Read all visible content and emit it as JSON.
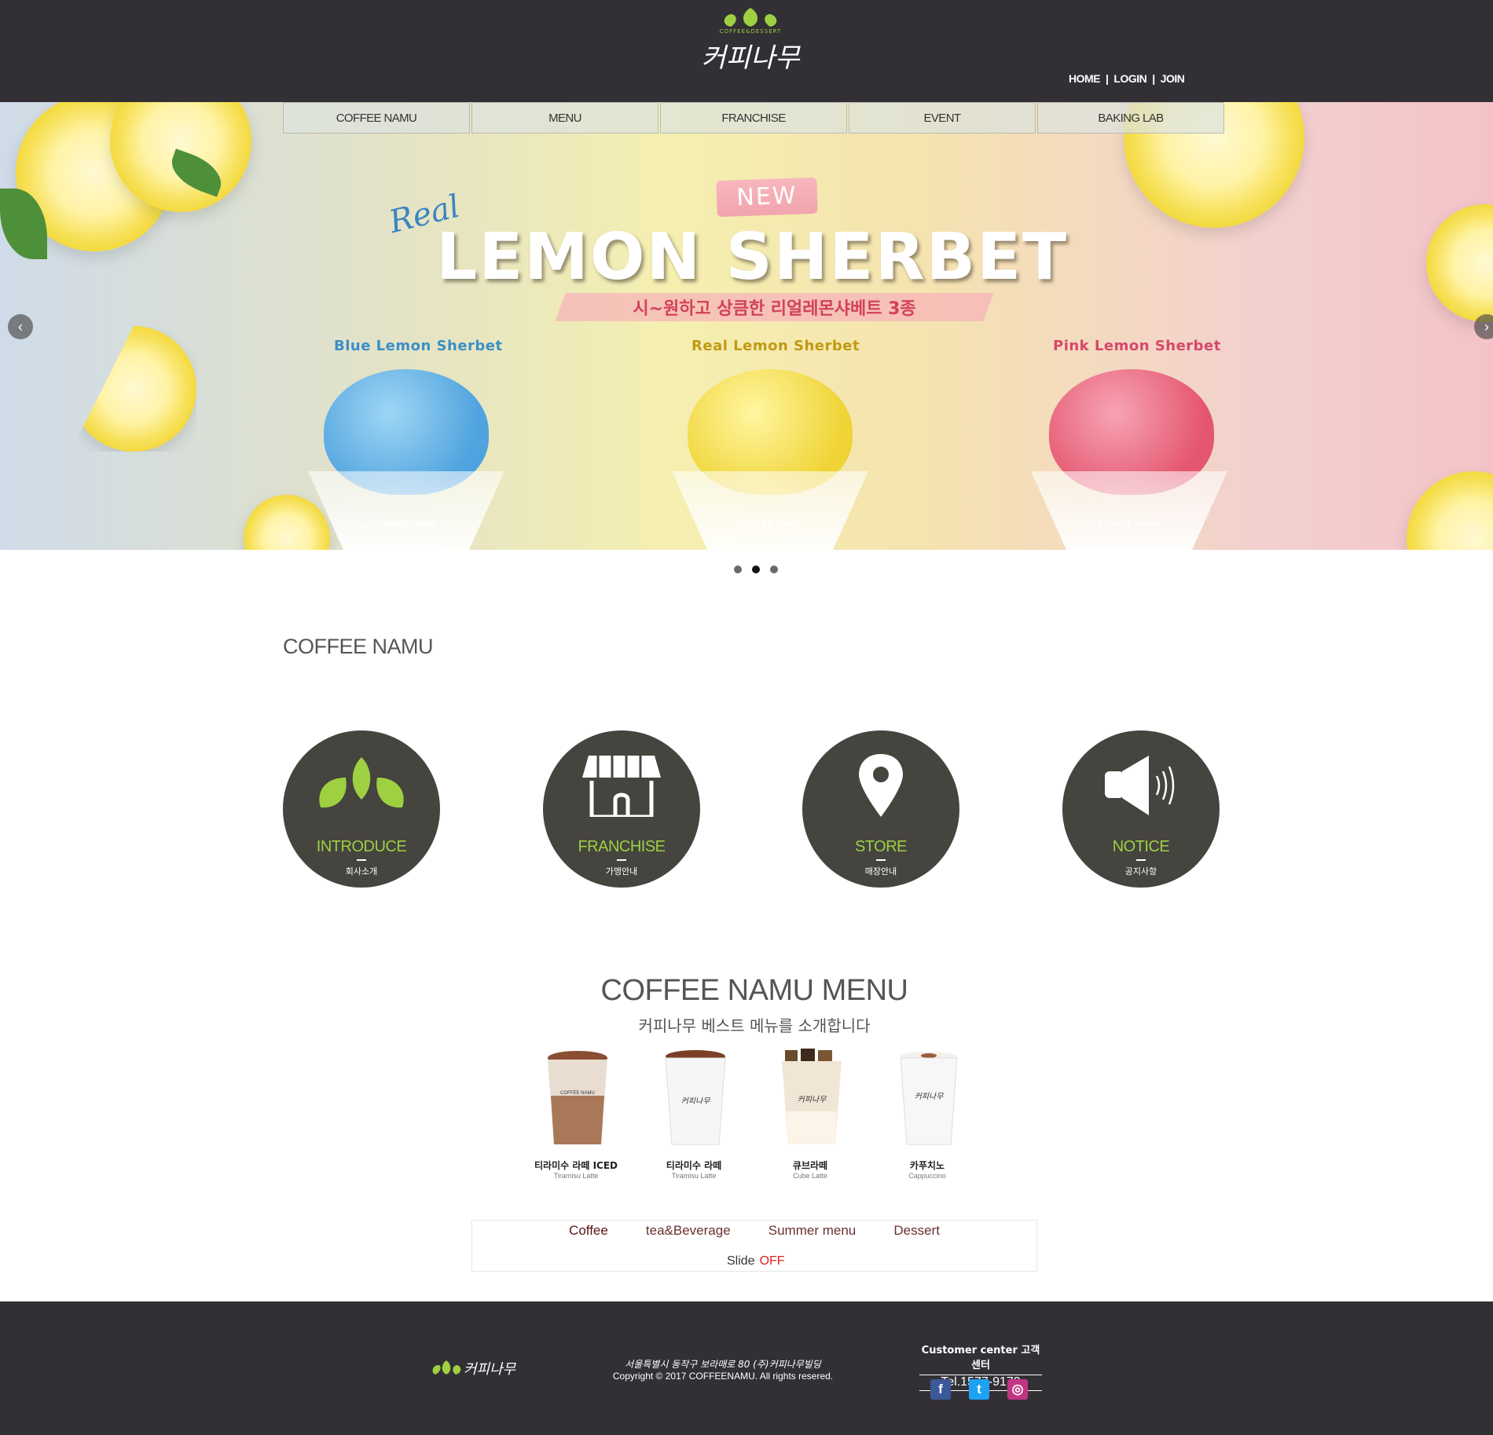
{
  "header": {
    "logo_tagline": "COFFEE&DESSERT",
    "logo_text": "커피나무",
    "top_links": [
      "HOME",
      "LOGIN",
      "JOIN"
    ]
  },
  "main_nav": [
    "COFFEE NAMU",
    "MENU",
    "FRANCHISE",
    "EVENT",
    "BAKING LAB"
  ],
  "hero": {
    "badge": "NEW",
    "script_word": "Real",
    "title": "LEMON SHERBET",
    "subtitle": "시~원하고 상큼한 리얼레몬샤베트 3종",
    "flavors": [
      {
        "name": "Blue Lemon Sherbet",
        "color": "#3b8fc7"
      },
      {
        "name": "Real Lemon Sherbet",
        "color": "#c19a12"
      },
      {
        "name": "Pink Lemon Sherbet",
        "color": "#d8466a"
      }
    ],
    "cup_label": "COFFEE NAMU",
    "prev_icon": "chevron-left-icon",
    "next_icon": "chevron-right-icon",
    "slide_count": 3,
    "active_slide": 2
  },
  "section": {
    "title": "COFFEE NAMU",
    "circles": [
      {
        "title": "INTRODUCE",
        "subtitle": "회사소개",
        "icon": "leaves-icon"
      },
      {
        "title": "FRANCHISE",
        "subtitle": "가맹안내",
        "icon": "shop-icon"
      },
      {
        "title": "STORE",
        "subtitle": "매장안내",
        "icon": "location-pin-icon"
      },
      {
        "title": "NOTICE",
        "subtitle": "공지사항",
        "icon": "megaphone-icon"
      }
    ]
  },
  "menu": {
    "title": "COFFEE NAMU MENU",
    "subtitle": "커피나무 베스트 메뉴를 소개합니다",
    "products": [
      {
        "name_ko": "티라미수 라떼 ICED",
        "name_en": "Tiramisu Latte"
      },
      {
        "name_ko": "티라미수 라떼",
        "name_en": "Tiramisu Latte"
      },
      {
        "name_ko": "큐브라떼",
        "name_en": "Cube Latte"
      },
      {
        "name_ko": "카푸치노",
        "name_en": "Cappuccino"
      }
    ],
    "tabs": [
      "Coffee",
      "tea&Beverage",
      "Summer menu",
      "Dessert"
    ],
    "active_tab": "Coffee",
    "slide_label": "Slide",
    "slide_state": "OFF"
  },
  "footer": {
    "logo_text": "커피나무",
    "address": "서울특별시 동작구 보라매로 80 (주)커피나무빌딩",
    "copyright": "Copyright © 2017 COFFEENAMU. All rights resered.",
    "cs_label": "Customer center 고객센터",
    "tel": "Tel.1577-9173",
    "social": [
      {
        "name": "facebook-icon",
        "glyph": "f",
        "color": "#3b5998"
      },
      {
        "name": "twitter-icon",
        "glyph": "t",
        "color": "#1da1f2"
      },
      {
        "name": "instagram-icon",
        "glyph": "◎",
        "color": "#c13584"
      }
    ]
  },
  "colors": {
    "header_bg": "#333035",
    "accent_green": "#9ed042",
    "circle_bg": "#45443f"
  }
}
